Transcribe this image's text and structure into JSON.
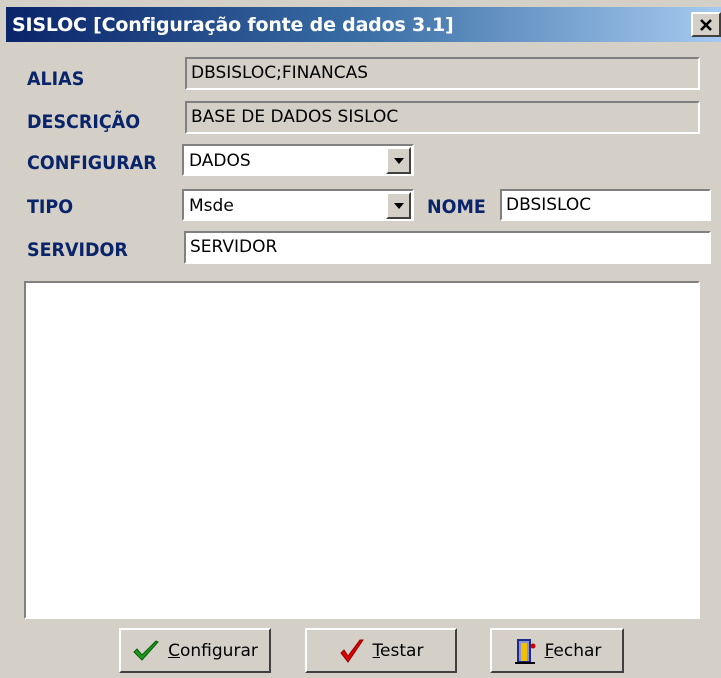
{
  "window": {
    "title": "SISLOC [Configuração fonte de dados 3.1]",
    "close_glyph": "×"
  },
  "form": {
    "alias_label": "ALIAS",
    "alias_value": "DBSISLOC;FINANCAS",
    "descricao_label": "DESCRIÇÃO",
    "descricao_value": "BASE DE DADOS SISLOC",
    "configurar_label": "CONFIGURAR",
    "configurar_value": "DADOS",
    "tipo_label": "TIPO",
    "tipo_value": "Msde",
    "nome_label": "NOME",
    "nome_value": "DBSISLOC",
    "servidor_label": "SERVIDOR",
    "servidor_value": "SERVIDOR"
  },
  "buttons": {
    "configurar_rest": "onfigurar",
    "configurar_mnemonic": "C",
    "testar_rest": "estar",
    "testar_mnemonic": "T",
    "fechar_rest": "echar",
    "fechar_mnemonic": "F"
  },
  "icons": {
    "configurar": "checkmark-green-icon",
    "testar": "checkmark-red-icon",
    "fechar": "door-exit-icon"
  },
  "colors": {
    "title_gradient_start": "#0a246a",
    "label_color": "#0a246a",
    "window_bg": "#d4d0c8"
  }
}
